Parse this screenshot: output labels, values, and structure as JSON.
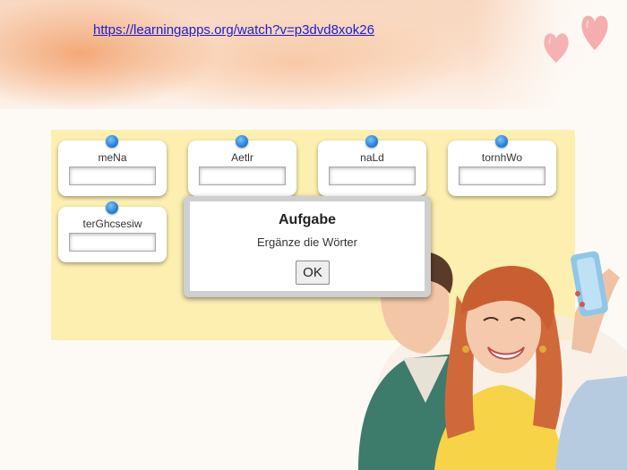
{
  "link": {
    "text": "https://learningapps.org/watch?v=p3dvd8xok26"
  },
  "cards": [
    {
      "word": "meNa",
      "value": ""
    },
    {
      "word": "Aetlr",
      "value": ""
    },
    {
      "word": "naLd",
      "value": ""
    },
    {
      "word": "tornhWo",
      "value": ""
    },
    {
      "word": "terGhcsesiw",
      "value": ""
    }
  ],
  "dialog": {
    "title": "Aufgabe",
    "text": "Ergänze die Wörter",
    "ok_label": "OK"
  },
  "colors": {
    "app_background": "#fcefb0",
    "pin": "#2b86dc",
    "link": "#1c1cd6"
  }
}
